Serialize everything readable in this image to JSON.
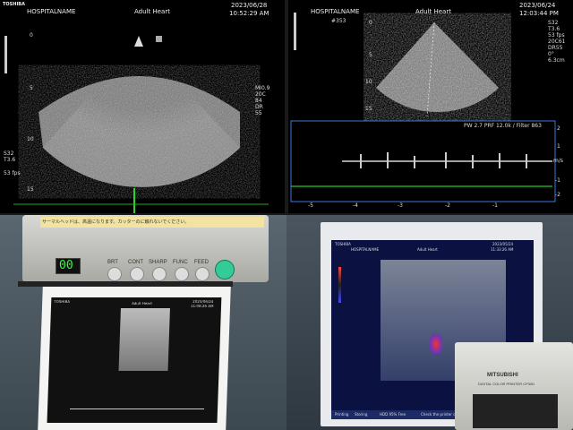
{
  "top_left": {
    "brand": "TOSHIBA",
    "hospital": "HOSPITALNAME",
    "preset": "Adult Heart",
    "date": "2023/06/28",
    "time": "10:52:29 AM",
    "depth_marks": [
      "0",
      "5",
      "10",
      "15"
    ],
    "params_right": [
      "MI0.9",
      "20C",
      "84",
      "DR",
      "55"
    ],
    "params_left": [
      "S32",
      "T3.6",
      "53 fps"
    ]
  },
  "top_right": {
    "date": "2023/06/24",
    "time": "12:03:44 PM",
    "preset": "Adult Heart",
    "hospital": "HOSPITALNAME",
    "params_right": [
      "S32",
      "T3.6",
      "53 fps",
      "20C61",
      "DR55",
      "0°",
      "6.3cm"
    ],
    "doppler_info": "PW 2.7 PRF 12.0k / Filter 863",
    "doppler_scale": [
      "2",
      "1",
      "m/s",
      "-1",
      "-2"
    ],
    "time_axis": [
      "-5",
      "-4",
      "-3",
      "-2",
      "-1"
    ],
    "depth_marks": [
      "0",
      "5",
      "10",
      "15"
    ],
    "cursor_label": "#353"
  },
  "bottom_left": {
    "printer_warning": "サーマルヘッドは、高温になります。カッターのに触れないでください。",
    "counter": "00",
    "buttons": [
      "BRT",
      "CONT",
      "SHARP",
      "FUNC",
      "FEED"
    ],
    "print_header": "TOSHIBA",
    "print_preset": "Adult Heart",
    "print_date": "2023/06/24",
    "print_time": "11:08:26 AM"
  },
  "bottom_right": {
    "brand": "TOSHIBA",
    "hospital": "HOSPITALNAME",
    "preset": "Adult Heart",
    "date": "2023/05/24",
    "time": "11:33:26 AM",
    "footer_items": [
      "Printing",
      "Storing",
      "HDD 95% Free",
      "Check the printer cables"
    ],
    "printer_brand": "MITSUBISHI",
    "printer_model": "DIGITAL COLOR PRINTER CP30D"
  }
}
